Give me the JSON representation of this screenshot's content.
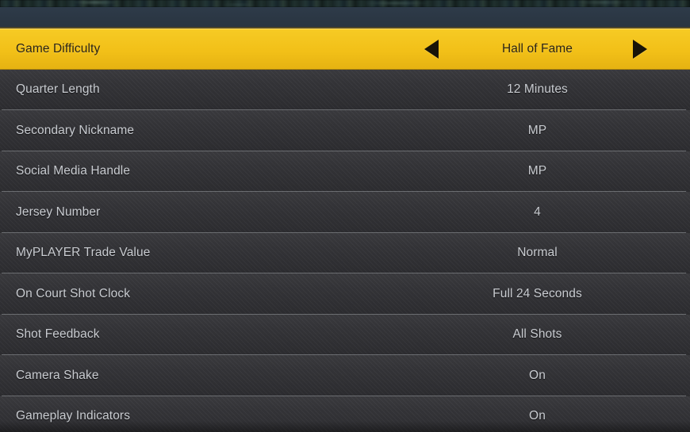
{
  "colors": {
    "selected_row": "#f2c21c",
    "row_background": "#333337",
    "row_text": "#c9ccd1",
    "selected_row_text": "#2b2415",
    "header_band": "#2b3744",
    "separator": "#c8cdd2"
  },
  "header": {
    "band_label": ""
  },
  "menu": {
    "rows": [
      {
        "label": "Game Difficulty",
        "value": "Hall of Fame",
        "selected": true
      },
      {
        "label": "Quarter Length",
        "value": "12 Minutes",
        "selected": false
      },
      {
        "label": "Secondary Nickname",
        "value": "MP",
        "selected": false
      },
      {
        "label": "Social Media Handle",
        "value": "MP",
        "selected": false
      },
      {
        "label": "Jersey Number",
        "value": "4",
        "selected": false
      },
      {
        "label": "MyPLAYER Trade Value",
        "value": "Normal",
        "selected": false
      },
      {
        "label": "On Court Shot Clock",
        "value": "Full 24 Seconds",
        "selected": false
      },
      {
        "label": "Shot Feedback",
        "value": "All Shots",
        "selected": false
      },
      {
        "label": "Camera Shake",
        "value": "On",
        "selected": false
      },
      {
        "label": "Gameplay Indicators",
        "value": "On",
        "selected": false
      }
    ],
    "prev_arrow_icon": "triangle-left-icon",
    "next_arrow_icon": "triangle-right-icon"
  }
}
